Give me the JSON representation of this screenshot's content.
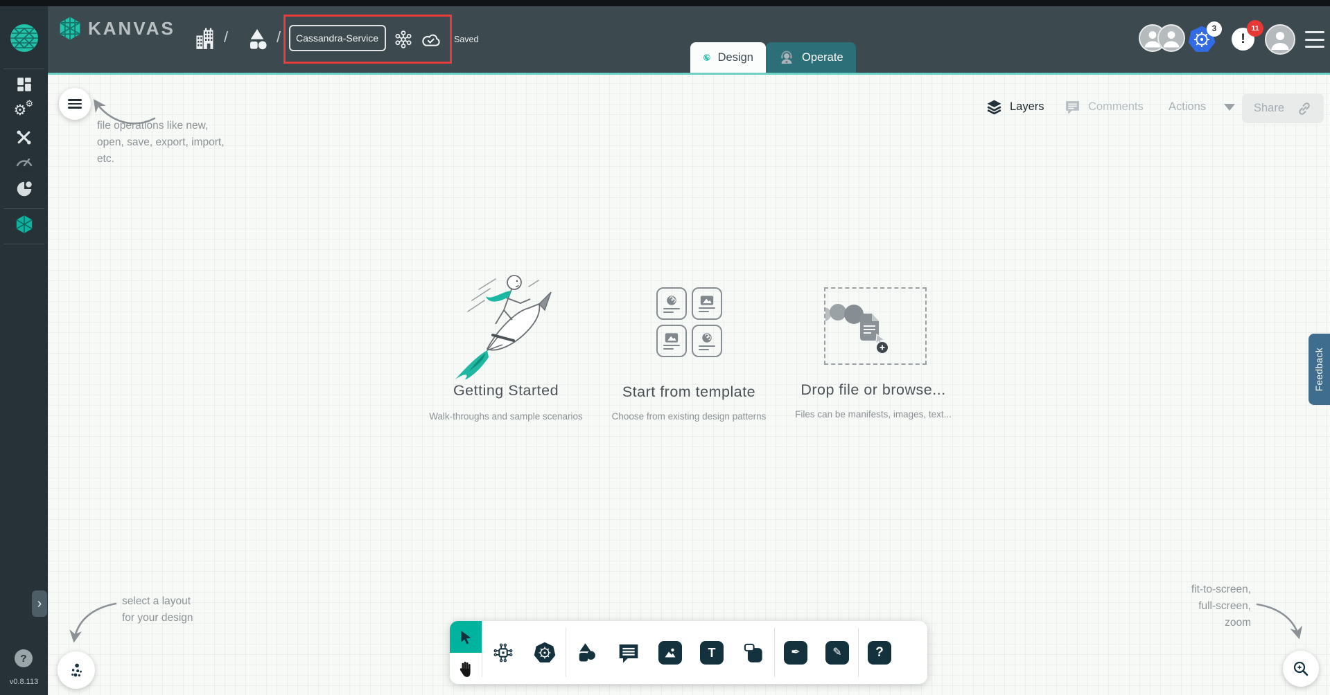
{
  "version": "v0.8.113",
  "colors": {
    "accent_teal": "#00B39F",
    "header_bg": "#3C494F",
    "sidebar_bg": "#263238",
    "annotation_red": "#E93B3B",
    "kubernetes_blue": "#326CE5",
    "badge_red": "#E53935",
    "operate_tab_bg": "#2D6F78",
    "feedback_bg": "#3E6D8D"
  },
  "header": {
    "logo_text": "KANVAS",
    "separator": "/",
    "design_name": "Cassandra-Service",
    "save_status": "Saved",
    "k8s_context_count": "3",
    "notification_count": "11",
    "tabs": [
      {
        "label": "Design"
      },
      {
        "label": "Operate"
      }
    ]
  },
  "panel": {
    "layers_label": "Layers",
    "comments_label": "Comments",
    "actions_label": "Actions",
    "share_label": "Share"
  },
  "empty_state": {
    "cards": [
      {
        "title": "Getting Started",
        "subtitle": "Walk-throughs and sample scenarios"
      },
      {
        "title": "Start from template",
        "subtitle": "Choose from existing design patterns"
      },
      {
        "title": "Drop file or browse...",
        "subtitle": "Files can be manifests, images, text..."
      }
    ]
  },
  "annotations": {
    "file_ops_lines": [
      "file operations like new,",
      "open, save, export, import,",
      "etc."
    ],
    "layout_lines": [
      "select a layout",
      "for your design"
    ],
    "zoom_lines": [
      "fit-to-screen,",
      "full-screen,",
      "zoom"
    ]
  },
  "feedback_label": "Feedback",
  "glyphs": {
    "text_tool": "T",
    "help_tool": "?",
    "pen_tool": "✒",
    "doodle_tool": "✎",
    "chevron_right": "›",
    "help_fab": "?",
    "exclamation": "!",
    "gear": "⚙"
  }
}
